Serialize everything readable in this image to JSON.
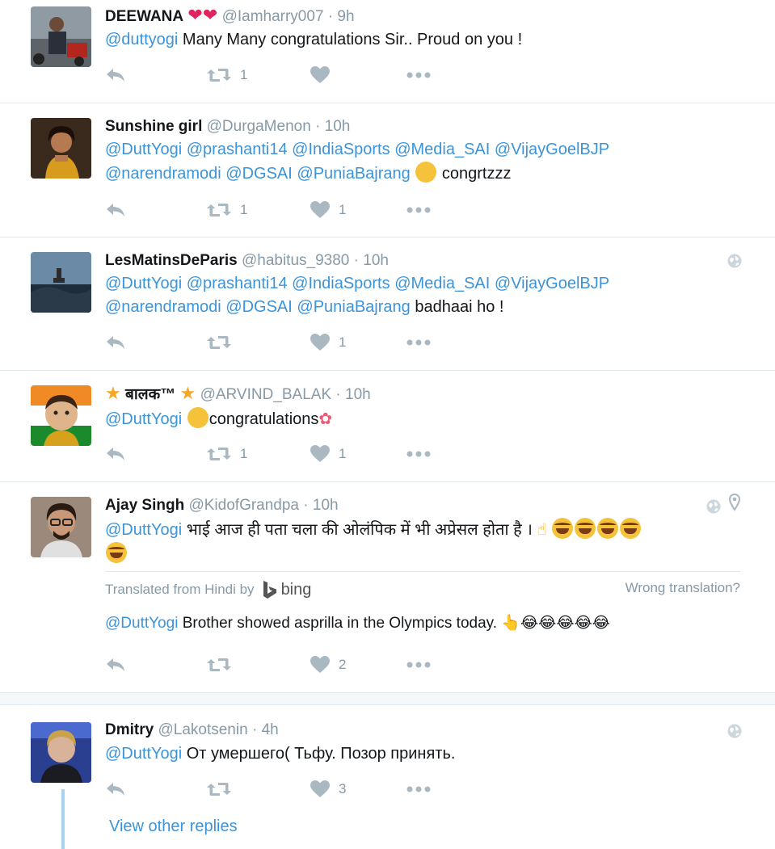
{
  "tweets": [
    {
      "name": "DEEWANA",
      "name_suffix": "❤❤",
      "handle": "@Iamharry007",
      "time": "9h",
      "text_parts": [
        {
          "mention": "@duttyogi"
        },
        {
          "plain": " Many Many congratulations Sir.. Proud on you !"
        }
      ],
      "retweets": "1",
      "likes": ""
    },
    {
      "name": "Sunshine girl",
      "handle": "@DurgaMenon",
      "time": "10h",
      "line1": [
        "@DuttYogi",
        "@prashanti14",
        "@IndiaSports",
        "@Media_SAI",
        "@VijayGoelBJP"
      ],
      "line2": [
        "@narendramodi",
        "@DGSAI",
        "@PuniaBajrang"
      ],
      "line2_tail": "congrtzzz",
      "retweets": "1",
      "likes": "1"
    },
    {
      "name": "LesMatinsDeParis",
      "handle": "@habitus_9380",
      "time": "10h",
      "line1": [
        "@DuttYogi",
        "@prashanti14",
        "@IndiaSports",
        "@Media_SAI",
        "@VijayGoelBJP"
      ],
      "line2": [
        "@narendramodi",
        "@DGSAI",
        "@PuniaBajrang"
      ],
      "line2_tail": "badhaai ho !",
      "retweets": "",
      "likes": "1"
    },
    {
      "name": "बालक™",
      "handle": "@ARVIND_BALAK",
      "time": "10h",
      "mention": "@DuttYogi",
      "text": "congratulations",
      "retweets": "1",
      "likes": "1"
    },
    {
      "name": "Ajay Singh",
      "handle": "@KidofGrandpa",
      "time": "10h",
      "mention": "@DuttYogi",
      "text": "भाई आज ही पता चला की ओलंपिक में भी अप्रेसल होता है ।",
      "translated_from": "Translated from Hindi by",
      "bing": "bing",
      "wrong_translation": "Wrong translation?",
      "translated_mention": "@DuttYogi",
      "translated_text": "Brother showed asprilla in the Olympics today. 👆😂😂😂😂😂",
      "retweets": "",
      "likes": "2"
    },
    {
      "name": "Dmitry",
      "handle": "@Lakotsenin",
      "time": "4h",
      "mention": "@DuttYogi",
      "text": "От умершего( Тьфу. Позор принять.",
      "retweets": "",
      "likes": "3"
    }
  ],
  "view_other_replies": "View other replies",
  "colors": {
    "link": "#3b94d9",
    "meta": "#8899a6",
    "divider": "#e1e8ed",
    "icon": "#aab8c2"
  }
}
